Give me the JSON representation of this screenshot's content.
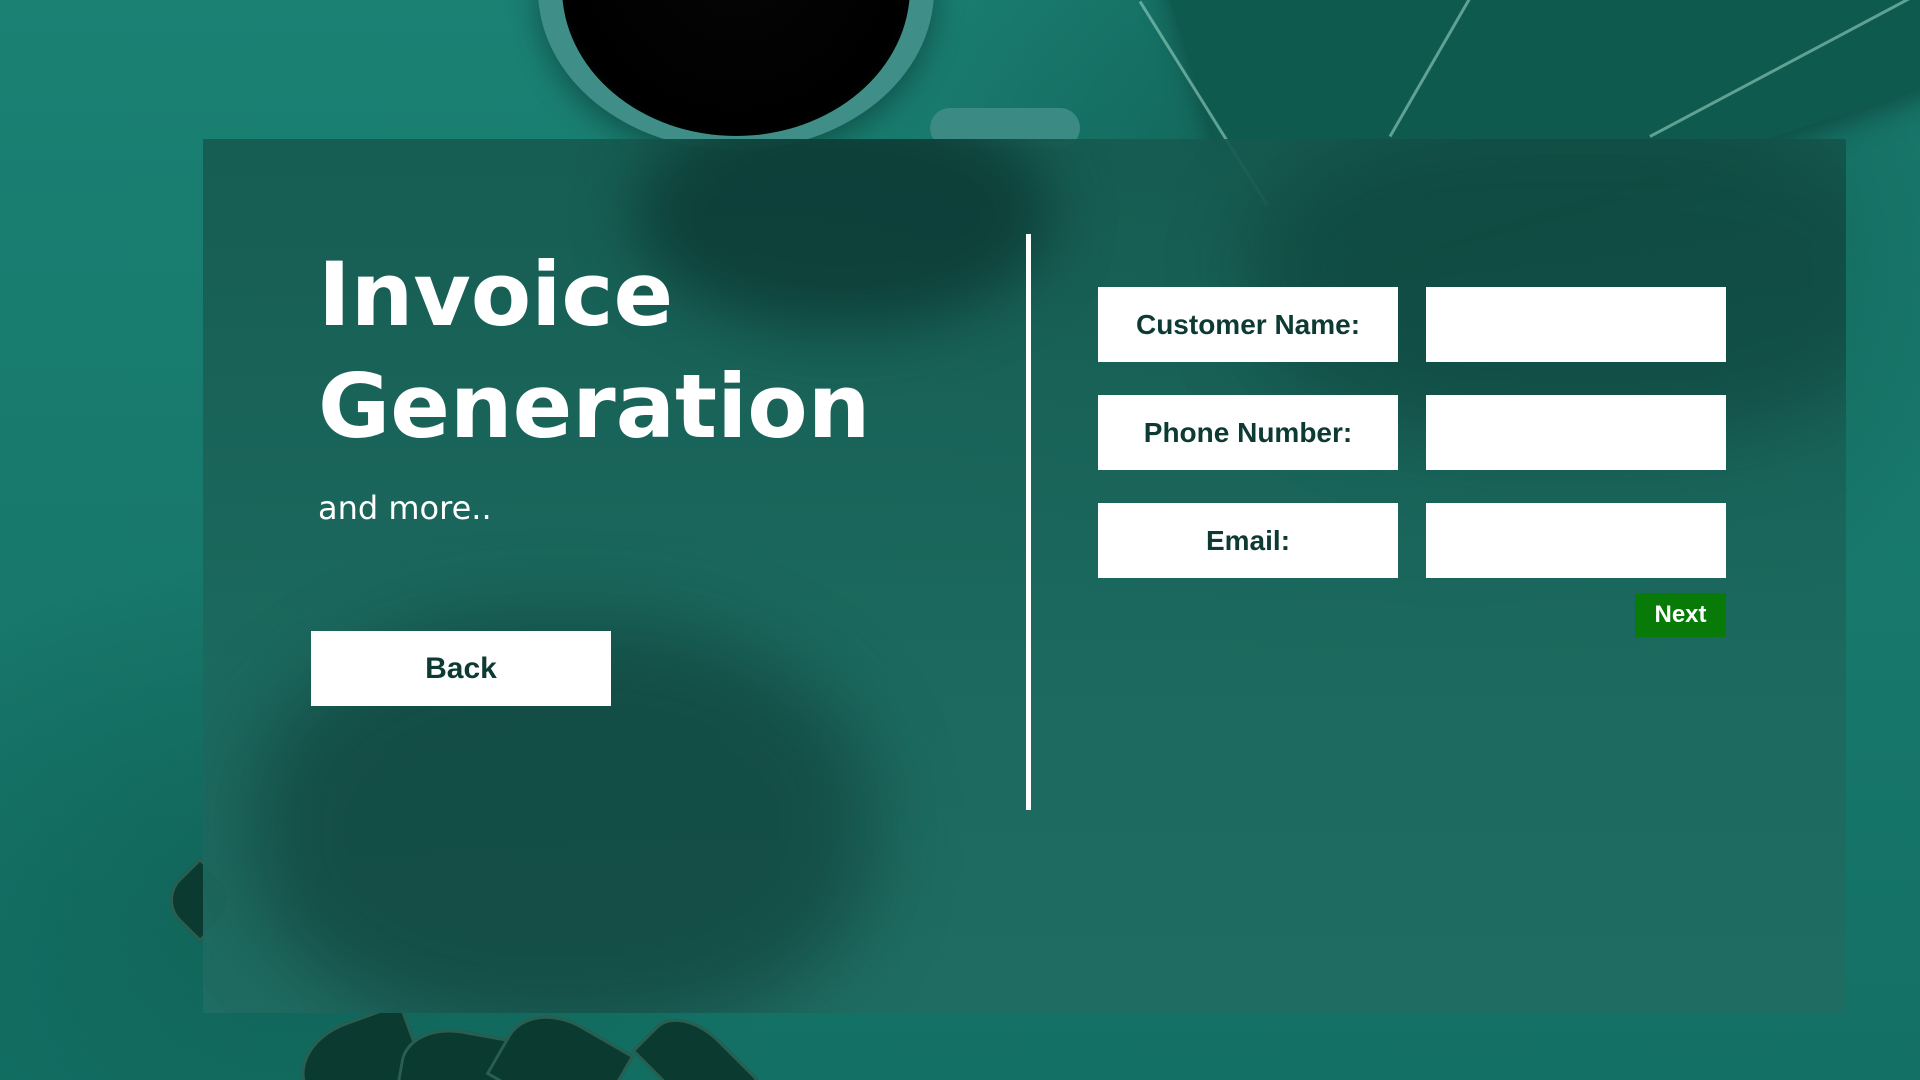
{
  "hero": {
    "title_line1": "Invoice",
    "title_line2": "Generation",
    "subtitle": "and more.."
  },
  "buttons": {
    "back_label": "Back",
    "next_label": "Next"
  },
  "form": {
    "fields": [
      {
        "label": "Customer Name:",
        "value": "",
        "placeholder": ""
      },
      {
        "label": "Phone Number:",
        "value": "",
        "placeholder": ""
      },
      {
        "label": "Email:",
        "value": "",
        "placeholder": ""
      }
    ]
  },
  "colors": {
    "background_teal": "#167a6c",
    "panel": "#1c685e",
    "label_text": "#0d3b33",
    "next_button": "#077a07",
    "white": "#ffffff"
  }
}
